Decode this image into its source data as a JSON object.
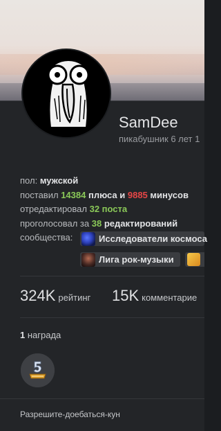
{
  "profile": {
    "username": "SamDee",
    "subtitle": "пикабушник 6 лет 1"
  },
  "info": {
    "gender_label": "пол:",
    "gender_value": "мужской",
    "posted_label": "поставил",
    "pluses": "14384",
    "pluses_label": "плюса и",
    "minuses": "9885",
    "minuses_label": "минусов",
    "edited_label": "отредактировал",
    "edited_value": "32 поста",
    "voted_label": "проголосовал за",
    "voted_count": "38",
    "voted_suffix": "редактирований",
    "communities_label": "сообщества:"
  },
  "communities": [
    {
      "name": "Исследователи космоса"
    },
    {
      "name": "Лига рок-музыки"
    }
  ],
  "stats": {
    "rating_value": "324K",
    "rating_label": "рейтинг",
    "comments_value": "15K",
    "comments_label": "комментарие"
  },
  "awards": {
    "count": "1",
    "label": "награда",
    "badge_text": "5 ЛЕТ"
  },
  "footer": {
    "text": "Разрешите-доебаться-кун"
  },
  "colors": {
    "background": "#232528",
    "positive": "#8ac858",
    "negative": "#e64646"
  }
}
